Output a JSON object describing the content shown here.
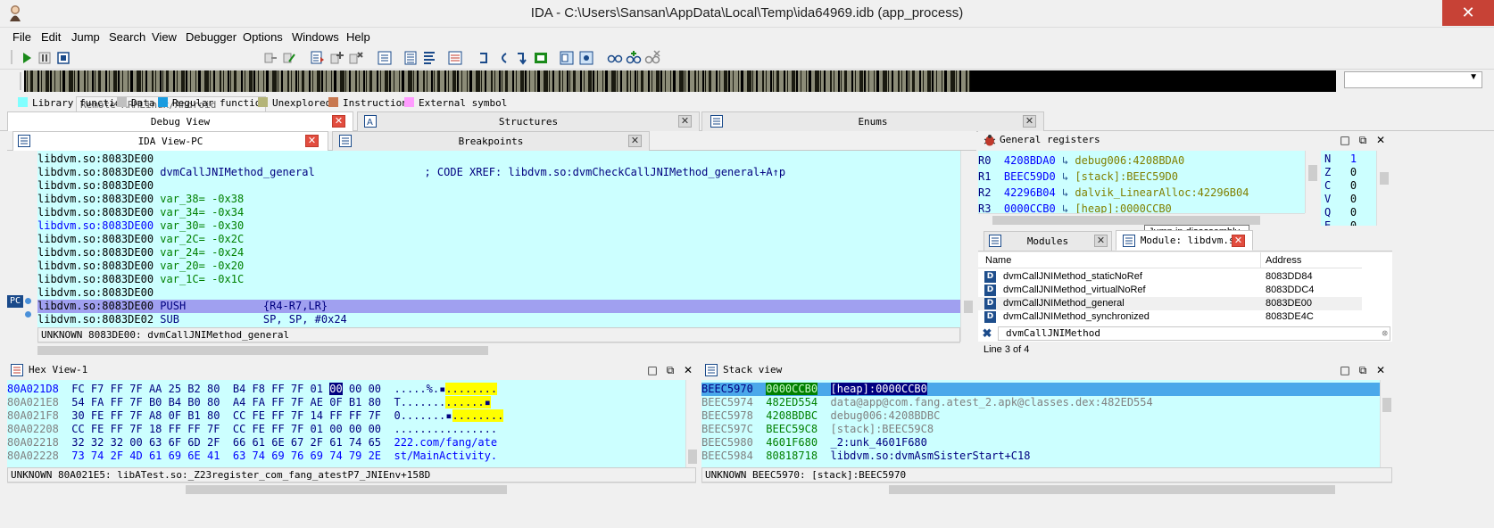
{
  "window": {
    "title": "IDA - C:\\Users\\Sansan\\AppData\\Local\\Temp\\ida64969.idb (app_process)",
    "close_label": "✕"
  },
  "menu": [
    "File",
    "Edit",
    "Jump",
    "Search",
    "View",
    "Debugger",
    "Options",
    "Windows",
    "Help"
  ],
  "toolbar": {
    "debugger": "Remote ARMLinux/Android debugger"
  },
  "legend": [
    {
      "label": "Library function",
      "color": "#80ffff"
    },
    {
      "label": "Data",
      "color": "#c0c0c0"
    },
    {
      "label": "Regular function",
      "color": "#0080ff"
    },
    {
      "label": "Unexplored",
      "color": "#b4b478"
    },
    {
      "label": "Instruction",
      "color": "#c87850"
    },
    {
      "label": "External symbol",
      "color": "#ff9cff"
    }
  ],
  "top_tabs": [
    {
      "label": "Debug View",
      "icon": "debug-view-icon"
    },
    {
      "label": "Structures",
      "icon": "structures-icon"
    },
    {
      "label": "Enums",
      "icon": "enums-icon"
    }
  ],
  "sub_tabs": [
    {
      "label": "IDA View-PC",
      "icon": "ida-view-icon"
    },
    {
      "label": "Breakpoints",
      "icon": "breakpoints-icon"
    }
  ],
  "disasm": {
    "lines": [
      {
        "addr": "libdvm.so:8083DE00",
        "text": "",
        "addr_color": "black"
      },
      {
        "addr": "libdvm.so:8083DE00",
        "text": " dvmCallJNIMethod_general                 ; CODE XREF: libdvm.so:dvmCheckCallJNIMethod_general+A↑p",
        "addr_color": "black"
      },
      {
        "addr": "libdvm.so:8083DE00",
        "text": "",
        "addr_color": "black"
      },
      {
        "addr": "libdvm.so:8083DE00",
        "text": " var_38= -0x38",
        "addr_color": "black"
      },
      {
        "addr": "libdvm.so:8083DE00",
        "text": " var_34= -0x34",
        "addr_color": "black"
      },
      {
        "addr": "libdvm.so:8083DE00",
        "text": " var_30= -0x30",
        "addr_color": "blue"
      },
      {
        "addr": "libdvm.so:8083DE00",
        "text": " var_2C= -0x2C",
        "addr_color": "black"
      },
      {
        "addr": "libdvm.so:8083DE00",
        "text": " var_24= -0x24",
        "addr_color": "black"
      },
      {
        "addr": "libdvm.so:8083DE00",
        "text": " var_20= -0x20",
        "addr_color": "black"
      },
      {
        "addr": "libdvm.so:8083DE00",
        "text": " var_1C= -0x1C",
        "addr_color": "black"
      },
      {
        "addr": "libdvm.so:8083DE00",
        "text": "",
        "addr_color": "black"
      },
      {
        "addr": "libdvm.so:8083DE00",
        "text": " PUSH            {R4-R7,LR}",
        "addr_color": "black"
      },
      {
        "addr": "libdvm.so:8083DE02",
        "text": " SUB             SP, SP, #0x24",
        "addr_color": "black"
      }
    ],
    "pc_label": "PC",
    "status": "UNKNOWN 8083DE00: dvmCallJNIMethod_general"
  },
  "registers": {
    "title": "General registers",
    "rows": [
      {
        "name": "R0",
        "value": "4208BDA0",
        "ref": "debug006:4208BDA0"
      },
      {
        "name": "R1",
        "value": "BEEC59D0",
        "ref": "[stack]:BEEC59D0"
      },
      {
        "name": "R2",
        "value": "42296B04",
        "ref": "dalvik_LinearAlloc:42296B04"
      },
      {
        "name": "R3",
        "value": "0000CCB0",
        "ref": "[heap]:0000CCB0"
      }
    ],
    "flags": [
      {
        "name": "N",
        "value": "1"
      },
      {
        "name": "Z",
        "value": "0"
      },
      {
        "name": "C",
        "value": "0"
      },
      {
        "name": "V",
        "value": "0"
      },
      {
        "name": "Q",
        "value": "0"
      },
      {
        "name": "E",
        "value": "0"
      }
    ],
    "tooltip": "Jump in disassembly"
  },
  "modules": {
    "tabs": [
      {
        "label": "Modules"
      },
      {
        "label": "Module: libdvm.so"
      }
    ],
    "columns": [
      "Name",
      "Address"
    ],
    "rows": [
      {
        "name": "dvmCallJNIMethod_staticNoRef",
        "addr": "8083DD84"
      },
      {
        "name": "dvmCallJNIMethod_virtualNoRef",
        "addr": "8083DDC4"
      },
      {
        "name": "dvmCallJNIMethod_general",
        "addr": "8083DE00"
      },
      {
        "name": "dvmCallJNIMethod_synchronized",
        "addr": "8083DE4C"
      }
    ],
    "filter": "dvmCallJNIMethod",
    "status": "Line 3 of 4"
  },
  "hex": {
    "title": "Hex View-1",
    "rows": [
      {
        "addr": "80A021D8",
        "bytes": "FC F7 FF 7F AA 25 B2 80  B4 F8 FF 7F 01 ",
        "hl": "00",
        "rest": " 00 00",
        "ascii": ".....%.",
        "ascii2": "▪",
        "ascii3": "........"
      },
      {
        "addr": "80A021E8",
        "bytes": "54 FA FF 7F B0 B4 B0 80  A4 FA FF 7F AE 0F B1 80",
        "hl": "",
        "rest": "",
        "ascii": "T.......",
        "ascii2": "",
        "ascii3": "......▪"
      },
      {
        "addr": "80A021F8",
        "bytes": "30 FE FF 7F A8 0F B1 80  CC FE FF 7F 14 FF FF 7F",
        "hl": "",
        "rest": "",
        "ascii": "0.......",
        "ascii2": "▪",
        "ascii3": "........"
      },
      {
        "addr": "80A02208",
        "bytes": "CC FE FF 7F 18 FF FF 7F  CC FE FF 7F 01 00 00 00",
        "hl": "",
        "rest": "",
        "ascii": "................",
        "ascii2": "",
        "ascii3": ""
      },
      {
        "addr": "80A02218",
        "bytes": "32 32 32 00 63 6F 6D 2F  66 61 6E 67 2F 61 74 65",
        "hl": "",
        "rest": "",
        "ascii": "222.com/fang/ate",
        "ascii2": "",
        "ascii3": ""
      },
      {
        "addr": "80A02228",
        "bytes": "73 74 2F 4D 61 69 6E 41  63 74 69 76 69 74 79 2E",
        "hl": "",
        "rest": "",
        "ascii": "st/MainActivity.",
        "ascii2": "",
        "ascii3": ""
      }
    ],
    "status": "UNKNOWN 80A021E5: libATest.so:_Z23register_com_fang_atestP7_JNIEnv+158D"
  },
  "stack": {
    "title": "Stack view",
    "rows": [
      {
        "addr": "BEEC5970",
        "value": "0000CCB0",
        "ref": "[heap]:0000CCB0"
      },
      {
        "addr": "BEEC5974",
        "value": "482ED554",
        "ref": "data@app@com.fang.atest_2.apk@classes.dex:482ED554"
      },
      {
        "addr": "BEEC5978",
        "value": "4208BDBC",
        "ref": "debug006:4208BDBC"
      },
      {
        "addr": "BEEC597C",
        "value": "BEEC59C8",
        "ref": "[stack]:BEEC59C8"
      },
      {
        "addr": "BEEC5980",
        "value": "4601F680",
        "ref": "_2:unk_4601F680"
      },
      {
        "addr": "BEEC5984",
        "value": "80818718",
        "ref": "libdvm.so:dvmAsmSisterStart+C18"
      }
    ],
    "status": "UNKNOWN BEEC5970: [stack]:BEEC5970"
  }
}
